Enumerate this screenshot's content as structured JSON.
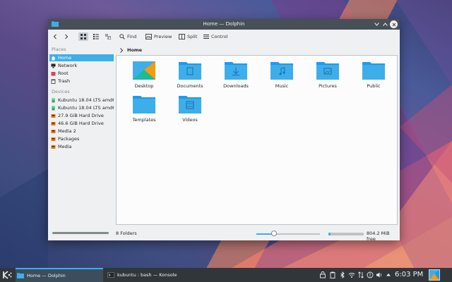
{
  "window": {
    "title": "Home — Dolphin"
  },
  "toolbar": {
    "find_label": "Find",
    "preview_label": "Preview",
    "split_label": "Split",
    "control_label": "Control"
  },
  "sidebar": {
    "places_header": "Places",
    "places": [
      {
        "label": "Home",
        "icon": "home-icon"
      },
      {
        "label": "Network",
        "icon": "network-icon"
      },
      {
        "label": "Root",
        "icon": "folder-red-icon"
      },
      {
        "label": "Trash",
        "icon": "trash-icon"
      }
    ],
    "devices_header": "Devices",
    "devices": [
      {
        "label": "Kubuntu 18.04 LTS amd64",
        "icon": "usb-drive-icon"
      },
      {
        "label": "Kubuntu 18.04 LTS amd64",
        "icon": "usb-drive-icon"
      },
      {
        "label": "27.9 GiB Hard Drive",
        "icon": "hard-drive-icon"
      },
      {
        "label": "46.6 GiB Hard Drive",
        "icon": "hard-drive-icon"
      },
      {
        "label": "Media 2",
        "icon": "hard-drive-icon"
      },
      {
        "label": "Packages",
        "icon": "hard-drive-icon"
      },
      {
        "label": "Media",
        "icon": "hard-drive-icon"
      }
    ]
  },
  "breadcrumb": {
    "current": "Home"
  },
  "folders": [
    {
      "label": "Desktop",
      "icon": "desktop-folder-icon"
    },
    {
      "label": "Documents",
      "icon": "documents-folder-icon"
    },
    {
      "label": "Downloads",
      "icon": "downloads-folder-icon"
    },
    {
      "label": "Music",
      "icon": "music-folder-icon"
    },
    {
      "label": "Pictures",
      "icon": "pictures-folder-icon"
    },
    {
      "label": "Public",
      "icon": "public-folder-icon"
    },
    {
      "label": "Templates",
      "icon": "templates-folder-icon"
    },
    {
      "label": "Videos",
      "icon": "videos-folder-icon"
    }
  ],
  "status": {
    "count": "8 Folders",
    "free_space": "804.2 MiB free",
    "zoom_fraction": 0.28,
    "used_fraction": 0.06
  },
  "taskbar": {
    "tasks": [
      {
        "label": "Home — Dolphin",
        "active": true
      },
      {
        "label": "kubuntu : bash — Konsole",
        "active": false
      }
    ],
    "clock": "6:03 PM"
  },
  "colors": {
    "accent": "#3daee9",
    "folder": "#3daee9",
    "titlebar": "#475057",
    "panel": "#31363b"
  }
}
